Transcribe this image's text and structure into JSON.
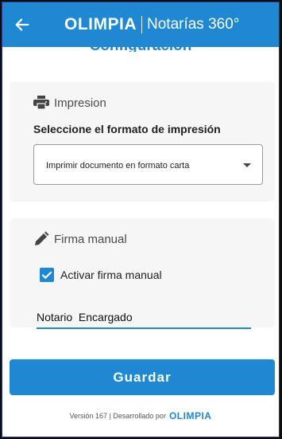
{
  "header": {
    "brand_logo": "OLIMPIA",
    "brand_sub": "Notarías 360°"
  },
  "page": {
    "title": "Configuración"
  },
  "print_section": {
    "heading": "Impresion",
    "format_label": "Seleccione el formato de impresión",
    "format_value": "Imprimir documento en formato carta"
  },
  "signature_section": {
    "heading": "Firma manual",
    "checkbox_label": "Activar firma manual",
    "checkbox_checked": true,
    "name_value": "Notario  Encargado"
  },
  "actions": {
    "save_label": "Guardar"
  },
  "footer": {
    "version_text": "Versión 167 | Desarrollado por",
    "logo": "OLIMPIA"
  },
  "colors": {
    "primary": "#1e88d2",
    "card_bg": "#f6f6f6"
  }
}
